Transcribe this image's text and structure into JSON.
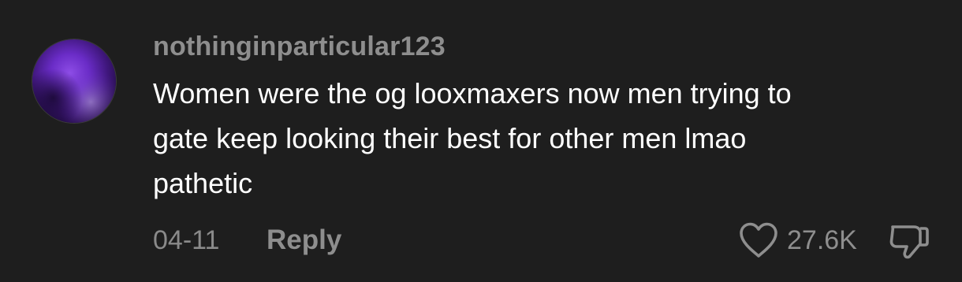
{
  "comment": {
    "username": "nothinginparticular123",
    "text_lines": [
      "Women were the og looxmaxers now men trying to",
      "gate keep looking their best for other men lmao",
      "pathetic"
    ],
    "date": "04-11",
    "reply_label": "Reply",
    "like_count": "27.6K",
    "like_icon": "heart-outline-icon",
    "dislike_icon": "thumbs-down-outline-icon"
  },
  "colors": {
    "background": "#1e1e1e",
    "username": "#8e8e8e",
    "text": "#ffffff",
    "meta": "#8a8a8a",
    "avatar_accent": "#6b2fc2"
  }
}
